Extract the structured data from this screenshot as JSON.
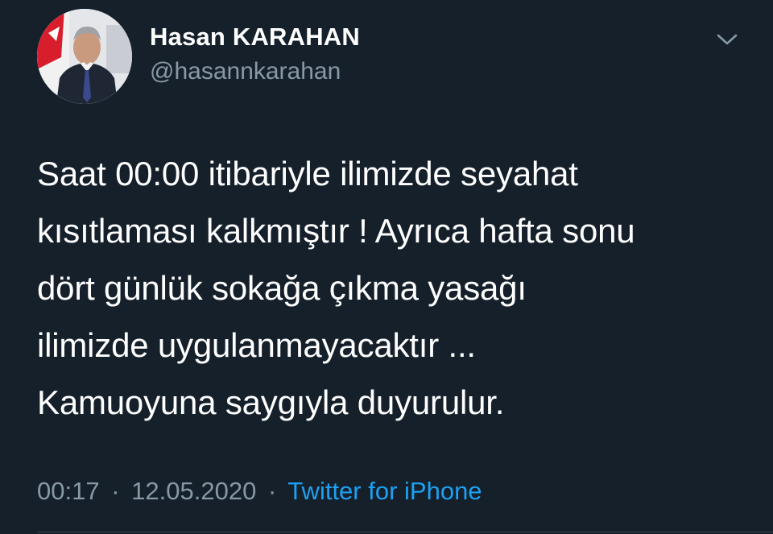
{
  "tweet": {
    "display_name": "Hasan KARAHAN",
    "handle": "@hasannkarahan",
    "text_lines": [
      "Saat 00:00 itibariyle ilimizde seyahat",
      "kısıtlaması kalkmıştır ! Ayrıca hafta sonu",
      "dört günlük sokağa çıkma yasağı",
      "ilimizde uygulanmayacaktır ...",
      "Kamuoyuna saygıyla duyurulur."
    ],
    "time": "00:17",
    "separator": "·",
    "date": "12.05.2020",
    "source": "Twitter for iPhone"
  },
  "icons": {
    "menu": "chevron-down-icon"
  },
  "colors": {
    "background": "#15202b",
    "primary_text": "#ffffff",
    "secondary_text": "#8899a6",
    "link": "#1da1f2"
  }
}
